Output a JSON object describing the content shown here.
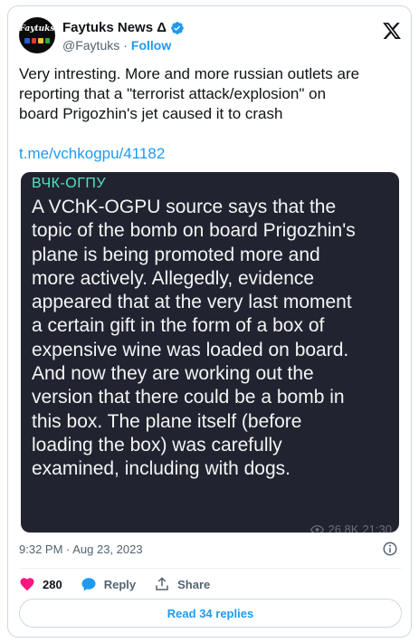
{
  "author": {
    "display_name": "Faytuks News Δ",
    "handle": "@Faytuks",
    "separator": "·",
    "follow_label": "Follow",
    "avatar_text": "Faytuks"
  },
  "tweet": {
    "text_lines": [
      "Very intresting. More and more russian outlets are",
      "reporting that a \"terrorist attack/explosion\" on",
      "board Prigozhin's jet caused it to crash"
    ],
    "link": "t.me/vchkogpu/41182"
  },
  "telegram_post": {
    "channel": "ВЧК-ОГПУ",
    "body_lines": [
      "A VChK-OGPU source says that the",
      "topic of the bomb on board Prigozhin's",
      "plane is being promoted more and",
      "more actively. Allegedly, evidence",
      "appeared that at the very last moment",
      "a certain gift in the form of a box of",
      "expensive wine was loaded on board.",
      "And now they are working out the",
      "version that there could be a bomb in",
      "this box. The plane itself (before",
      "loading the box) was carefully",
      "examined, including with dogs."
    ],
    "views": "26.8K",
    "time": "21:30"
  },
  "timestamp": "9:32 PM · Aug 23, 2023",
  "actions": {
    "likes": "280",
    "reply_label": "Reply",
    "share_label": "Share"
  },
  "read_replies_label": "Read 34 replies",
  "colors": {
    "accent": "#1d9bf0",
    "like": "#f91880",
    "telegram_bg": "#212430",
    "channel_name": "#4fe3c3"
  },
  "icons": [
    "verified-badge-icon",
    "x-logo-icon",
    "eye-icon",
    "info-icon",
    "heart-icon",
    "reply-icon",
    "share-icon"
  ]
}
